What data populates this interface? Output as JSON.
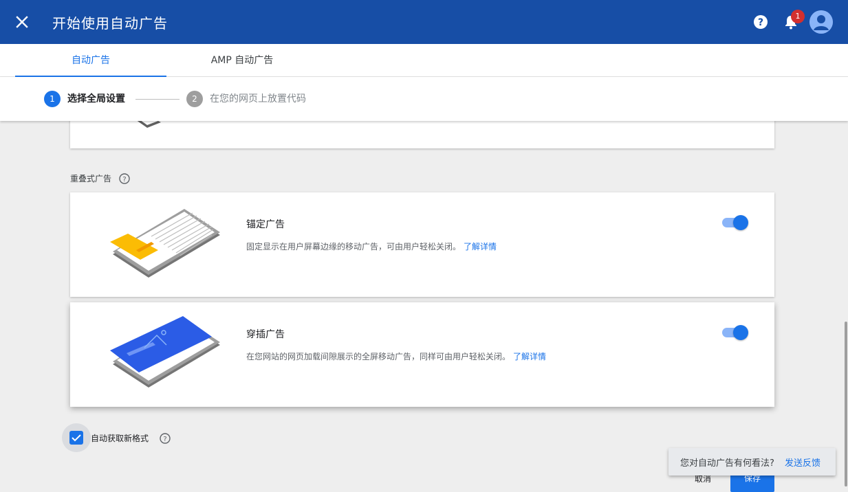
{
  "header": {
    "title": "开始使用自动广告",
    "notification_count": "1",
    "icons": [
      "close-icon",
      "help-icon",
      "bell-icon",
      "account-icon"
    ],
    "bg_color": "#174ea6"
  },
  "tabs": [
    {
      "label": "自动广告",
      "active": true
    },
    {
      "label": "AMP 自动广告",
      "active": false
    }
  ],
  "stepper": {
    "steps": [
      {
        "number": "1",
        "label": "选择全局设置",
        "active": true
      },
      {
        "number": "2",
        "label": "在您的网页上放置代码",
        "active": false
      }
    ]
  },
  "overlay_section": {
    "label": "重叠式广告",
    "cards": [
      {
        "title": "锚定广告",
        "description": "固定显示在用户屏幕边缘的移动广告，可由用户轻松关闭。",
        "link": "了解详情",
        "enabled": true
      },
      {
        "title": "穿插广告",
        "description": "在您网站的网页加载间隙展示的全屏移动广告，同样可由用户轻松关闭。",
        "link": "了解详情",
        "enabled": true
      }
    ]
  },
  "auto_formats": {
    "label": "自动获取新格式",
    "checked": true
  },
  "actions": {
    "cancel": "取消",
    "save": "保存"
  },
  "feedback": {
    "question": "您对自动广告有何看法?",
    "link": "发送反馈"
  },
  "colors": {
    "accent": "#1a73e8",
    "badge": "#d32f2f",
    "highlight": "#fbbc04"
  }
}
